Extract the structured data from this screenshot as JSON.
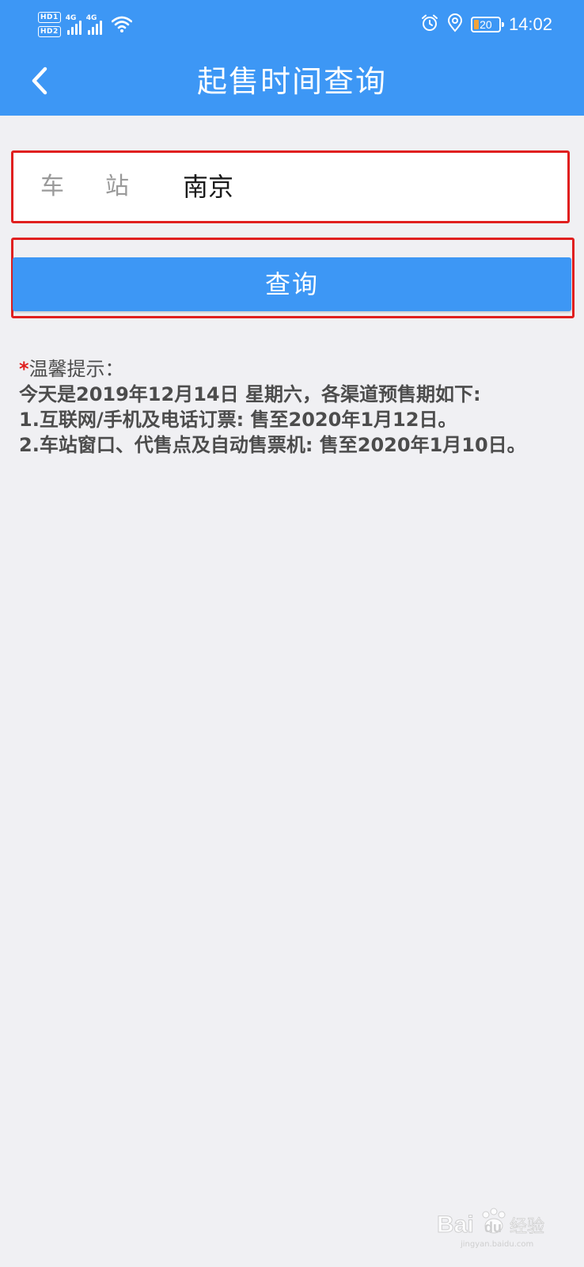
{
  "status_bar": {
    "hd_badges": [
      "HD1",
      "HD2"
    ],
    "network_labels": [
      "4G",
      "4G"
    ],
    "battery_level": "20",
    "time": "14:02",
    "icons": [
      "alarm-icon",
      "location-icon",
      "wifi-icon",
      "signal-icon",
      "battery-icon"
    ]
  },
  "header": {
    "title": "起售时间查询",
    "back_icon": "back-chevron-icon"
  },
  "form": {
    "station_label": "车站",
    "station_value": "南京",
    "query_button": "查询"
  },
  "tips": {
    "marker": "*",
    "heading": "温馨提示：",
    "line1": "今天是2019年12月14日 星期六，各渠道预售期如下:",
    "line2": "1.互联网/手机及电话订票: 售至2020年1月12日。",
    "line3": "2.车站窗口、代售点及自动售票机: 售至2020年1月10日。"
  },
  "colors": {
    "primary": "#3d97f5",
    "highlight_border": "#e01f1f",
    "background": "#f0f0f3",
    "tip_text": "#4c4c4c",
    "battery_fill": "#f2a33a"
  },
  "watermark": {
    "brand": "Baidu",
    "label": "经验",
    "url": "jingyan.baidu.com"
  }
}
